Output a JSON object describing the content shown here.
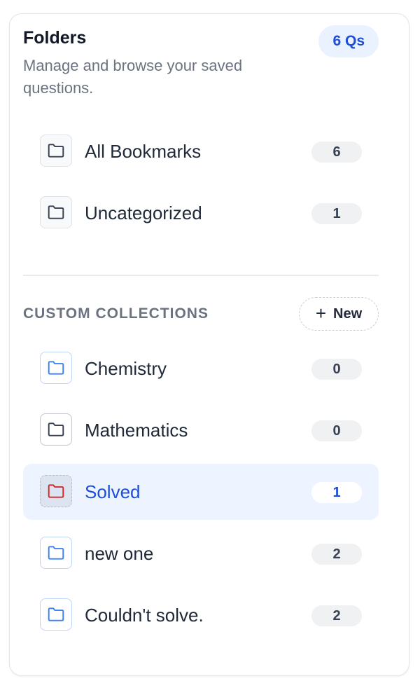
{
  "panel": {
    "title": "Folders",
    "subtitle": "Manage and browse your saved questions.",
    "question_badge": "6 Qs"
  },
  "default_folders": [
    {
      "label": "All Bookmarks",
      "count": "6",
      "icon": "folder-icon",
      "color": "#374151"
    },
    {
      "label": "Uncategorized",
      "count": "1",
      "icon": "folder-icon",
      "color": "#374151"
    }
  ],
  "custom_section": {
    "title": "CUSTOM COLLECTIONS",
    "new_button_label": "New",
    "new_button_icon": "plus-icon"
  },
  "collections": [
    {
      "label": "Chemistry",
      "count": "0",
      "icon": "folder-icon",
      "color": "#3b82f6"
    },
    {
      "label": "Mathematics",
      "count": "0",
      "icon": "folder-icon",
      "color": "#374151"
    },
    {
      "label": "Solved",
      "count": "1",
      "icon": "folder-icon",
      "color": "#dc2626",
      "selected": true
    },
    {
      "label": "new one",
      "count": "2",
      "icon": "folder-icon",
      "color": "#3b82f6"
    },
    {
      "label": "Couldn't solve.",
      "count": "2",
      "icon": "folder-icon",
      "color": "#3b82f6"
    }
  ],
  "theme": {
    "accent": "#1d4ed8",
    "selected_background": "#eef4ff"
  }
}
